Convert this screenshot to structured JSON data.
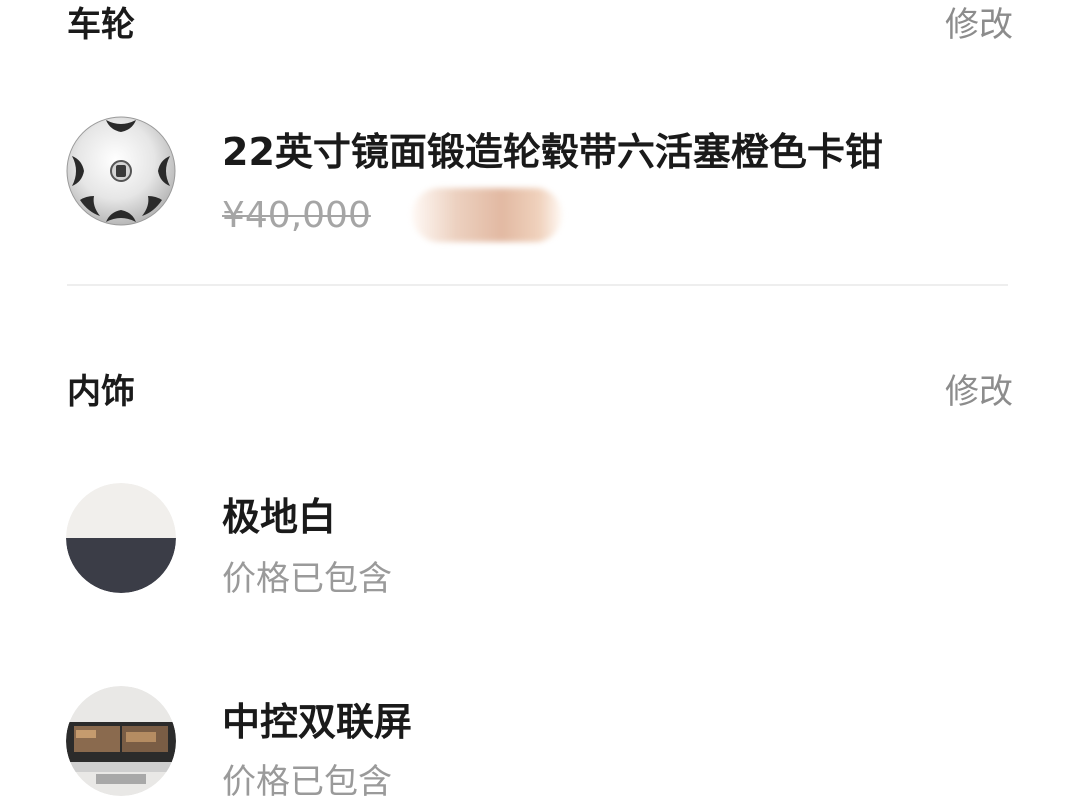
{
  "wheels": {
    "title": "车轮",
    "edit_label": "修改",
    "item": {
      "icon": "wheel-rim-image",
      "name": "22英寸镜面锻造轮毂带六活塞橙色卡钳",
      "original_price": "¥40,000"
    }
  },
  "interior": {
    "title": "内饰",
    "edit_label": "修改",
    "items": [
      {
        "icon": "color-swatch-white-dark",
        "name": "极地白",
        "price_note": "价格已包含"
      },
      {
        "icon": "dual-screen-dashboard-image",
        "name": "中控双联屏",
        "price_note": "价格已包含"
      }
    ]
  }
}
